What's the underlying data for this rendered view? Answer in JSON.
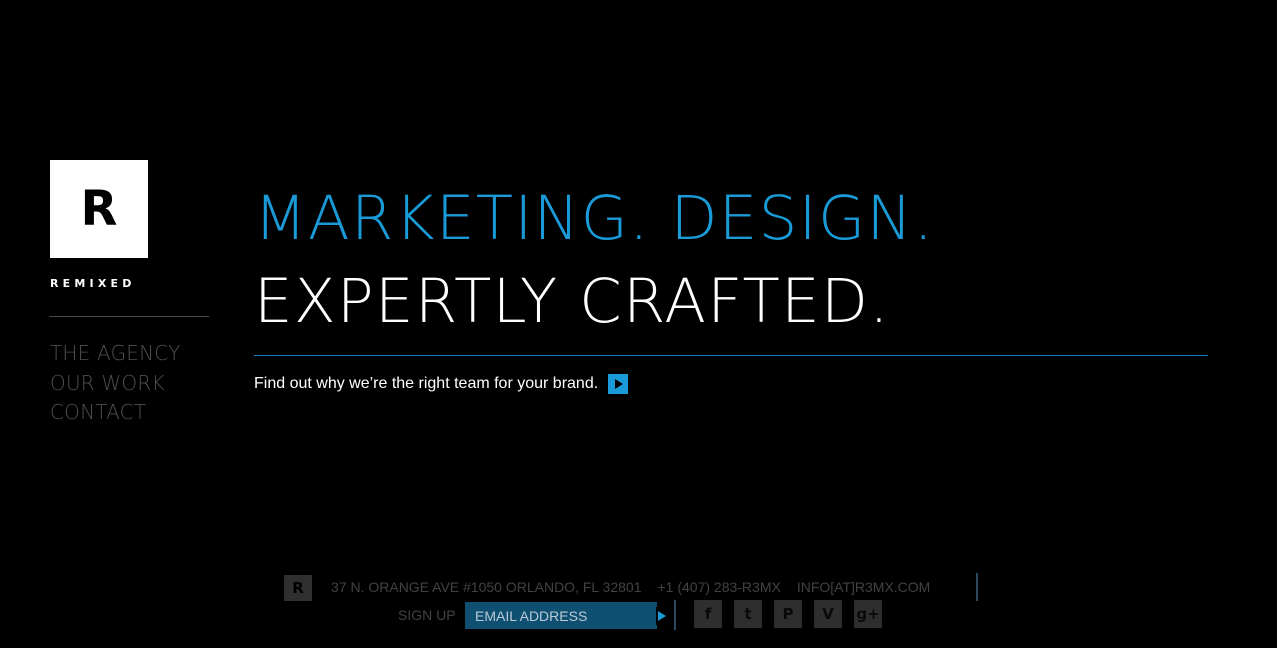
{
  "brand": {
    "logo_letter": "R",
    "wordmark": "REMIXED"
  },
  "nav": {
    "items": [
      {
        "label": "THE AGENCY"
      },
      {
        "label": "OUR WORK"
      },
      {
        "label": "CONTACT"
      }
    ]
  },
  "hero": {
    "line1": "MARKETING. DESIGN.",
    "line2": "EXPERTLY CRAFTED.",
    "tagline": "Find out why we’re the right team for your brand."
  },
  "footer": {
    "address": "37 N. ORANGE AVE #1050 ORLANDO, FL 32801",
    "phone": "+1 (407) 283-R3MX",
    "email": "INFO[AT]R3MX.COM",
    "signup_label": "SIGN UP",
    "email_placeholder": "EMAIL ADDRESS",
    "social": [
      {
        "name": "facebook-icon",
        "glyph": "f"
      },
      {
        "name": "twitter-icon",
        "glyph": "t"
      },
      {
        "name": "pinterest-icon",
        "glyph": "P"
      },
      {
        "name": "vimeo-icon",
        "glyph": "V"
      },
      {
        "name": "google-plus-icon",
        "glyph": "g+"
      }
    ]
  },
  "colors": {
    "accent": "#1a9ad6",
    "background": "#000000",
    "nav_text": "#4f4f4f",
    "footer_text": "#424242",
    "signup_bg": "#0f4f72"
  }
}
